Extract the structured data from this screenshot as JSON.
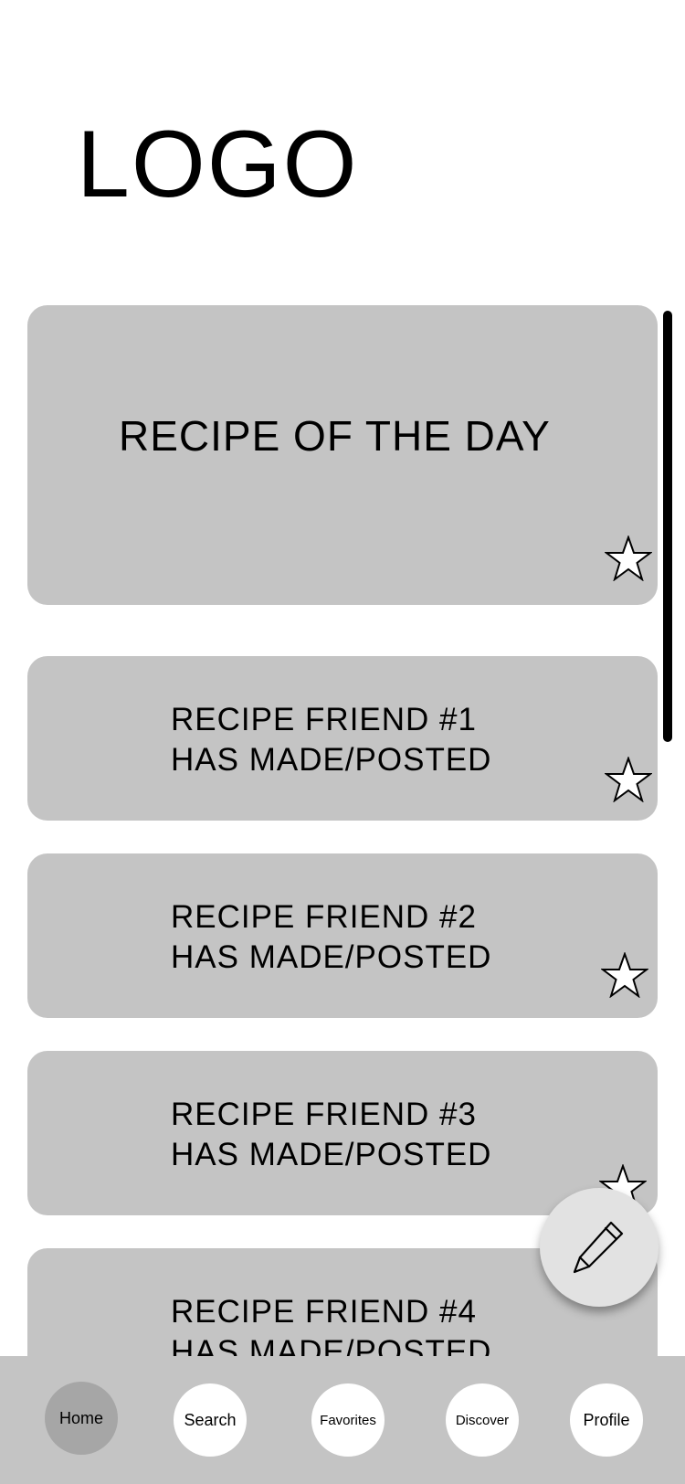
{
  "header": {
    "logo_text": "LOGO"
  },
  "feed": {
    "recipe_of_the_day": {
      "title": "RECIPE OF THE DAY",
      "star_icon": "star-outline-icon"
    },
    "friend_posts": [
      {
        "line1": "RECIPE FRIEND #1",
        "line2": "HAS MADE/POSTED"
      },
      {
        "line1": "RECIPE FRIEND #2",
        "line2": "HAS MADE/POSTED"
      },
      {
        "line1": "RECIPE FRIEND #3",
        "line2": "HAS MADE/POSTED"
      },
      {
        "line1": "RECIPE FRIEND #4",
        "line2": "HAS MADE/POSTED"
      }
    ]
  },
  "fab": {
    "icon": "pencil-icon"
  },
  "nav": {
    "items": [
      {
        "label": "Home",
        "active": true
      },
      {
        "label": "Search",
        "active": false
      },
      {
        "label": "Favorites",
        "active": false
      },
      {
        "label": "Discover",
        "active": false
      },
      {
        "label": "Profile",
        "active": false
      }
    ]
  },
  "colors": {
    "card_bg": "#c4c4c4",
    "nav_bg": "#c4c4c4",
    "active_nav": "#a6a6a6",
    "fab_bg": "#e2e2e2"
  }
}
